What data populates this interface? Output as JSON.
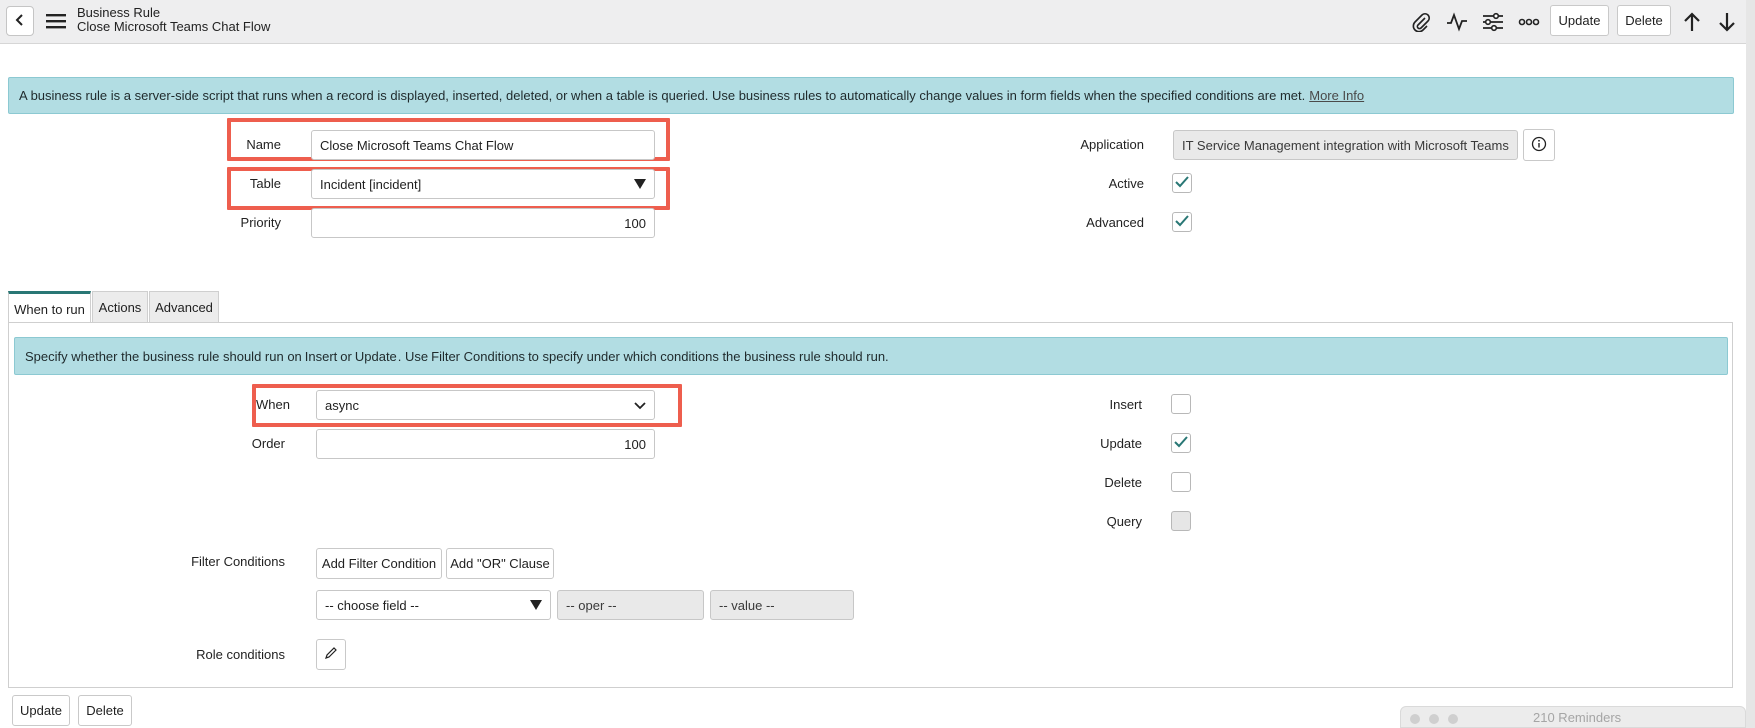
{
  "header": {
    "record_type": "Business Rule",
    "record_name": "Close Microsoft Teams Chat Flow",
    "icons": [
      "back-icon",
      "menu-icon",
      "paperclip-icon",
      "activity-icon",
      "sliders-icon",
      "more-icon",
      "arrow-up-icon",
      "arrow-down-icon"
    ],
    "update_label": "Update",
    "delete_label": "Delete"
  },
  "intro_banner": {
    "text": "A business rule is a server-side script that runs when a record is displayed, inserted, deleted, or when a table is queried. Use business rules to automatically change values in form fields when the specified conditions are met.",
    "link": "More Info"
  },
  "form": {
    "name_label": "Name",
    "name_value": "Close Microsoft Teams Chat Flow",
    "table_label": "Table",
    "table_value": "Incident [incident]",
    "priority_label": "Priority",
    "priority_value": "100",
    "application_label": "Application",
    "application_value": "IT Service Management integration with Microsoft Teams",
    "active_label": "Active",
    "active_checked": true,
    "advanced_label": "Advanced",
    "advanced_checked": true
  },
  "tabs": [
    {
      "label": "When to run",
      "active": true
    },
    {
      "label": "Actions",
      "active": false
    },
    {
      "label": "Advanced",
      "active": false
    }
  ],
  "when_to_run": {
    "banner": {
      "p1": "Specify whether the business rule should run on ",
      "b1": "Insert",
      "p2": " or ",
      "b2": "Update",
      "p3": ". Use ",
      "b3": "Filter Conditions",
      "p4": " to specify under which conditions the business rule should run."
    },
    "when_label": "When",
    "when_value": "async",
    "order_label": "Order",
    "order_value": "100",
    "insert_label": "Insert",
    "insert_checked": false,
    "update_label": "Update",
    "update_checked": true,
    "delete_label": "Delete",
    "delete_checked": false,
    "query_label": "Query",
    "query_checked": false,
    "filter_label": "Filter Conditions",
    "add_filter_label": "Add Filter Condition",
    "add_or_label": "Add \"OR\" Clause",
    "choose_field": "-- choose field --",
    "oper": "-- oper --",
    "value": "-- value --",
    "role_label": "Role conditions"
  },
  "footer": {
    "update_label": "Update",
    "delete_label": "Delete"
  },
  "reminders": "210 Reminders",
  "colors": {
    "banner_bg": "#b2dde3",
    "highlight": "#ee5e4e",
    "check": "#297775",
    "tab_accent": "#297775"
  }
}
